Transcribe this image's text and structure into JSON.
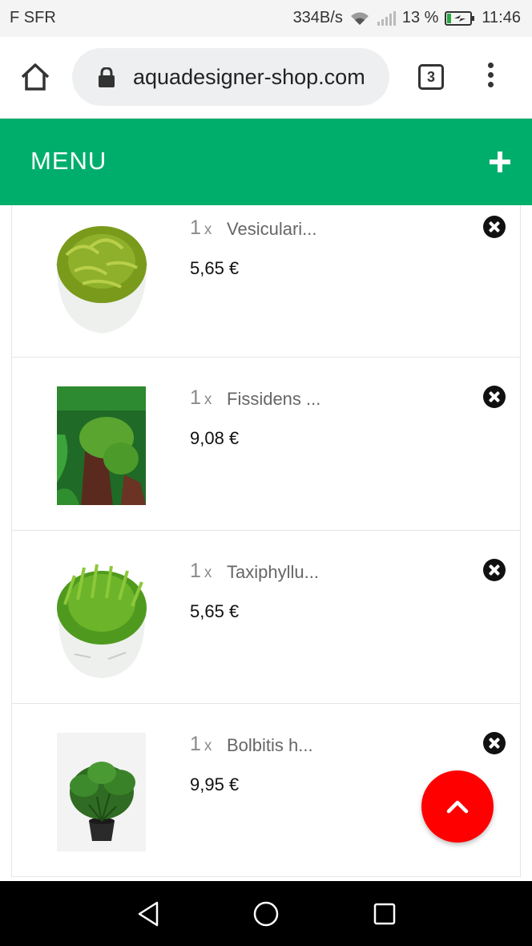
{
  "status_bar": {
    "carrier": "F SFR",
    "net_speed": "334B/s",
    "battery": "13 %",
    "time": "11:46"
  },
  "browser": {
    "url": "aquadesigner-shop.com",
    "tab_count": "3"
  },
  "header": {
    "menu_label": "MENU"
  },
  "cart": {
    "items": [
      {
        "qty": "1",
        "qty_sep": "x",
        "name": "Vesiculari...",
        "price": "5,65 €",
        "image": "potted-moss-cup-1"
      },
      {
        "qty": "1",
        "qty_sep": "x",
        "name": "Fissidens ...",
        "price": "9,08 €",
        "image": "moss-on-wood-photo"
      },
      {
        "qty": "1",
        "qty_sep": "x",
        "name": "Taxiphyllu...",
        "price": "5,65 €",
        "image": "potted-moss-cup-2"
      },
      {
        "qty": "1",
        "qty_sep": "x",
        "name": "Bolbitis h...",
        "price": "9,95 €",
        "image": "potted-fern-photo"
      }
    ]
  },
  "colors": {
    "menu_bar": "#00ae6b",
    "fab": "#fe0000"
  }
}
